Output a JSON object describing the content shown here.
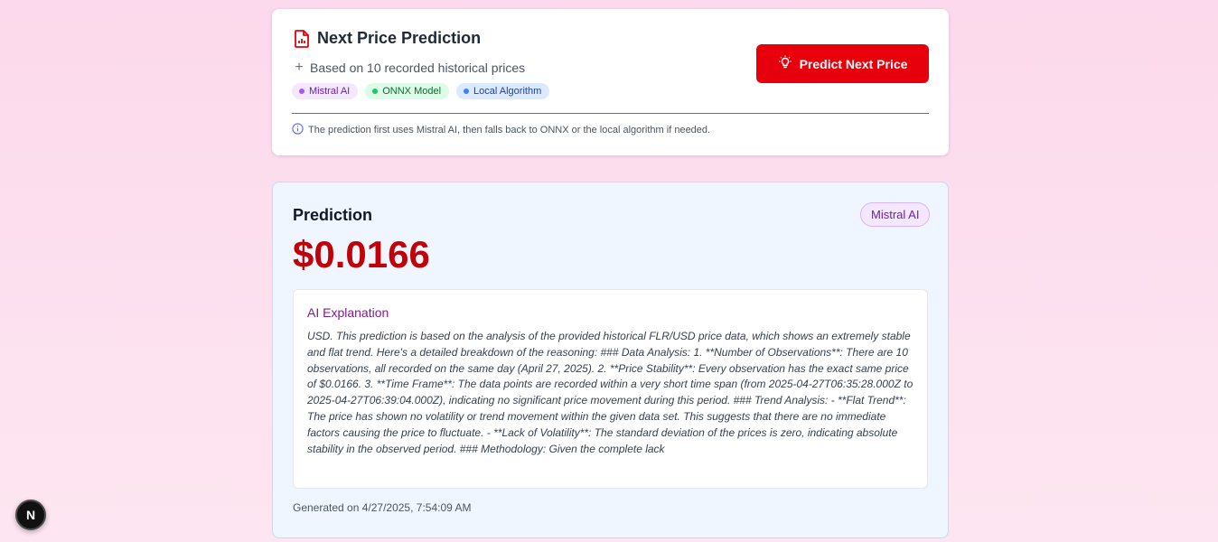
{
  "prediction_card": {
    "title": "Next Price Prediction",
    "subtitle": "Based on 10 recorded historical prices",
    "badges": [
      {
        "label": "Mistral AI",
        "color": "#a855f7"
      },
      {
        "label": "ONNX Model",
        "color": "#22c55e"
      },
      {
        "label": "Local Algorithm",
        "color": "#3b82f6"
      }
    ],
    "predict_button_label": "Predict Next Price",
    "note": "The prediction first uses Mistral AI, then falls back to ONNX or the local algorithm if needed.",
    "accent_color": "#e7000b"
  },
  "result": {
    "title": "Prediction",
    "source": "Mistral AI",
    "price": "$0.0166",
    "explanation_title": "AI Explanation",
    "explanation": "USD. This prediction is based on the analysis of the provided historical FLR/USD price data, which shows an extremely stable and flat trend. Here's a detailed breakdown of the reasoning: ### Data Analysis: 1. **Number of Observations**: There are 10 observations, all recorded on the same day (April 27, 2025). 2. **Price Stability**: Every observation has the exact same price of $0.0166. 3. **Time Frame**: The data points are recorded within a very short time span (from 2025-04-27T06:35:28.000Z to 2025-04-27T06:39:04.000Z), indicating no significant price movement during this period. ### Trend Analysis: - **Flat Trend**: The price has shown no volatility or trend movement within the given data set. This suggests that there are no immediate factors causing the price to fluctuate. - **Lack of Volatility**: The standard deviation of the prices is zero, indicating absolute stability in the observed period. ### Methodology: Given the complete lack",
    "generated": "Generated on 4/27/2025, 7:54:09 AM",
    "price_color": "#c10007"
  },
  "dev_badge": {
    "label": "N"
  }
}
